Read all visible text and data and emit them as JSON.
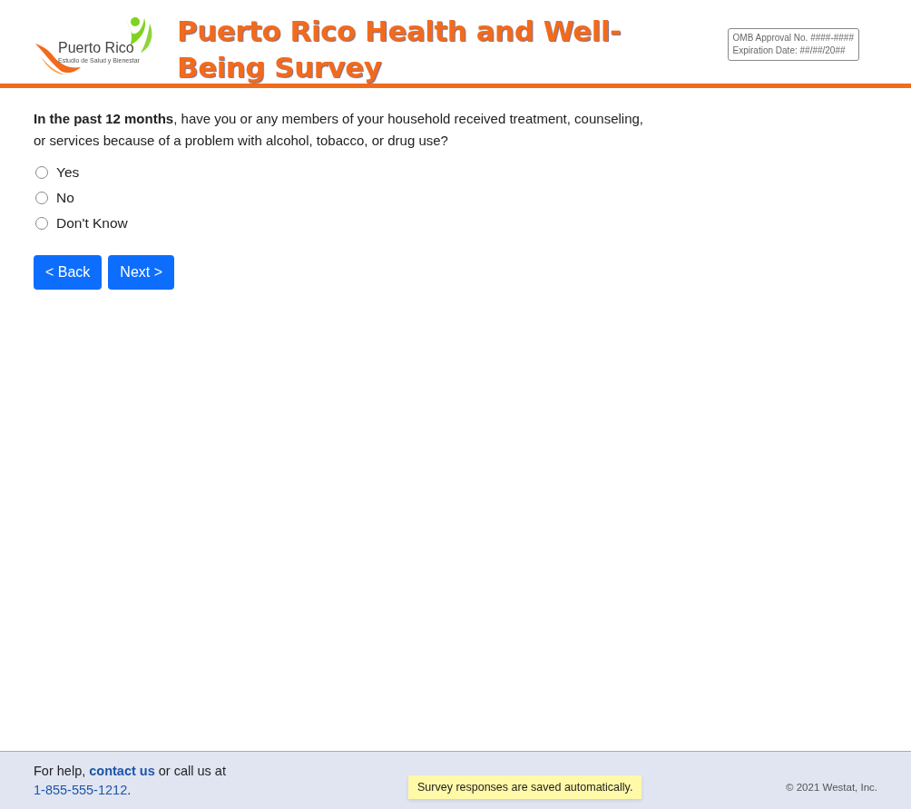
{
  "header": {
    "logo_name": "Puerto Rico",
    "logo_tagline": "Estudio de Salud y Bienestar",
    "title": "Puerto Rico Health and Well-Being Survey",
    "omb_lines": [
      "OMB Approval No. ####-####",
      "Expiration Date: ##/##/20##"
    ]
  },
  "question": {
    "text": "**In the past 12 months**, have you or any members of your household received treatment, counseling, or services because of a problem with alcohol, tobacco, or drug use?",
    "options": [
      {
        "label": "Yes",
        "selected": false
      },
      {
        "label": "No",
        "selected": false
      },
      {
        "label": "Don't Know",
        "selected": false
      }
    ]
  },
  "buttons": [
    "< Back",
    "Next >"
  ],
  "footer": {
    "help_prefix": "For help,",
    "contact_link": "contact us",
    "help_middle": "or call us at",
    "phone_link": "1-855-555-1212",
    "help_suffix": ".",
    "save_notice": "Survey responses are saved automatically.",
    "copyright": "© 2021 Westat, Inc."
  }
}
